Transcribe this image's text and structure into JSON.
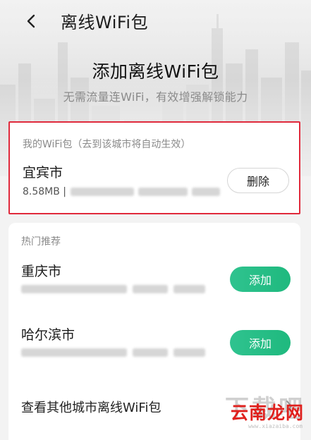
{
  "nav": {
    "title": "离线WiFi包"
  },
  "hero": {
    "headline": "添加离线WiFi包",
    "subline": "无需流量连WiFi，有效增强解锁能力"
  },
  "my_packages": {
    "section_label": "我的WiFi包（去到该城市将自动生效）",
    "items": [
      {
        "city": "宜宾市",
        "size": "8.58MB |",
        "action_label": "删除"
      }
    ]
  },
  "hot": {
    "section_label": "热门推荐",
    "items": [
      {
        "city": "重庆市",
        "action_label": "添加"
      },
      {
        "city": "哈尔滨市",
        "action_label": "添加"
      }
    ],
    "more_label": "查看其他城市离线WiFi包"
  },
  "watermark": {
    "gray_text": "下载吧",
    "main_text": "云南龙网",
    "url_text": "www.xiazaiba.com"
  },
  "colors": {
    "accent_green": "#22bb82",
    "highlight_red": "#e02a3c",
    "watermark_red": "#e0201d"
  },
  "icons": {
    "back": "chevron-left-icon",
    "more": "chevron-right-icon"
  }
}
